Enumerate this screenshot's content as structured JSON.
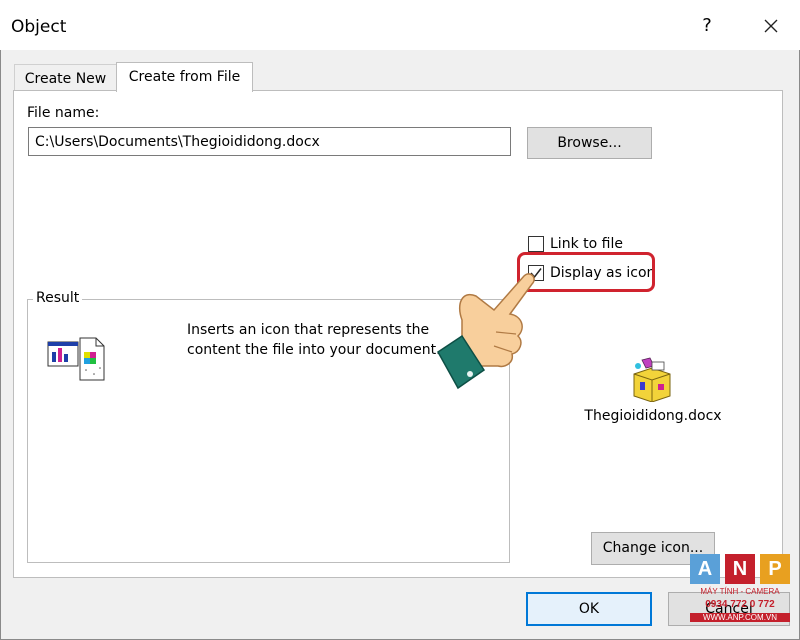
{
  "window": {
    "title": "Object",
    "help_label": "?"
  },
  "tabs": [
    {
      "label": "Create New",
      "active": false
    },
    {
      "label": "Create from File",
      "active": true
    }
  ],
  "file": {
    "name_label": "File name:",
    "name_value": "C:\\Users\\Documents\\Thegioididong.docx",
    "browse_label": "Browse..."
  },
  "options": {
    "link_to_file": {
      "label": "Link to file",
      "checked": false
    },
    "display_as_icon": {
      "label": "Display as icon",
      "checked": true
    }
  },
  "result": {
    "legend": "Result",
    "description": "Inserts an icon that represents the content the file into your document."
  },
  "icon_preview": {
    "filename": "Thegioididong.docx",
    "change_icon_label": "Change icon..."
  },
  "footer": {
    "ok_label": "OK",
    "cancel_label": "Cancel"
  },
  "watermark": {
    "letters": [
      "A",
      "N",
      "P"
    ],
    "line1": "MÁY TÍNH - CAMERA",
    "phone": "0934 772 0 772",
    "site": "WWW.ANP.COM.VN"
  },
  "colors": {
    "accent": "#0078d7",
    "highlight": "#d0232e",
    "panel": "#ffffff",
    "dialog_bg": "#f0f0f0"
  }
}
